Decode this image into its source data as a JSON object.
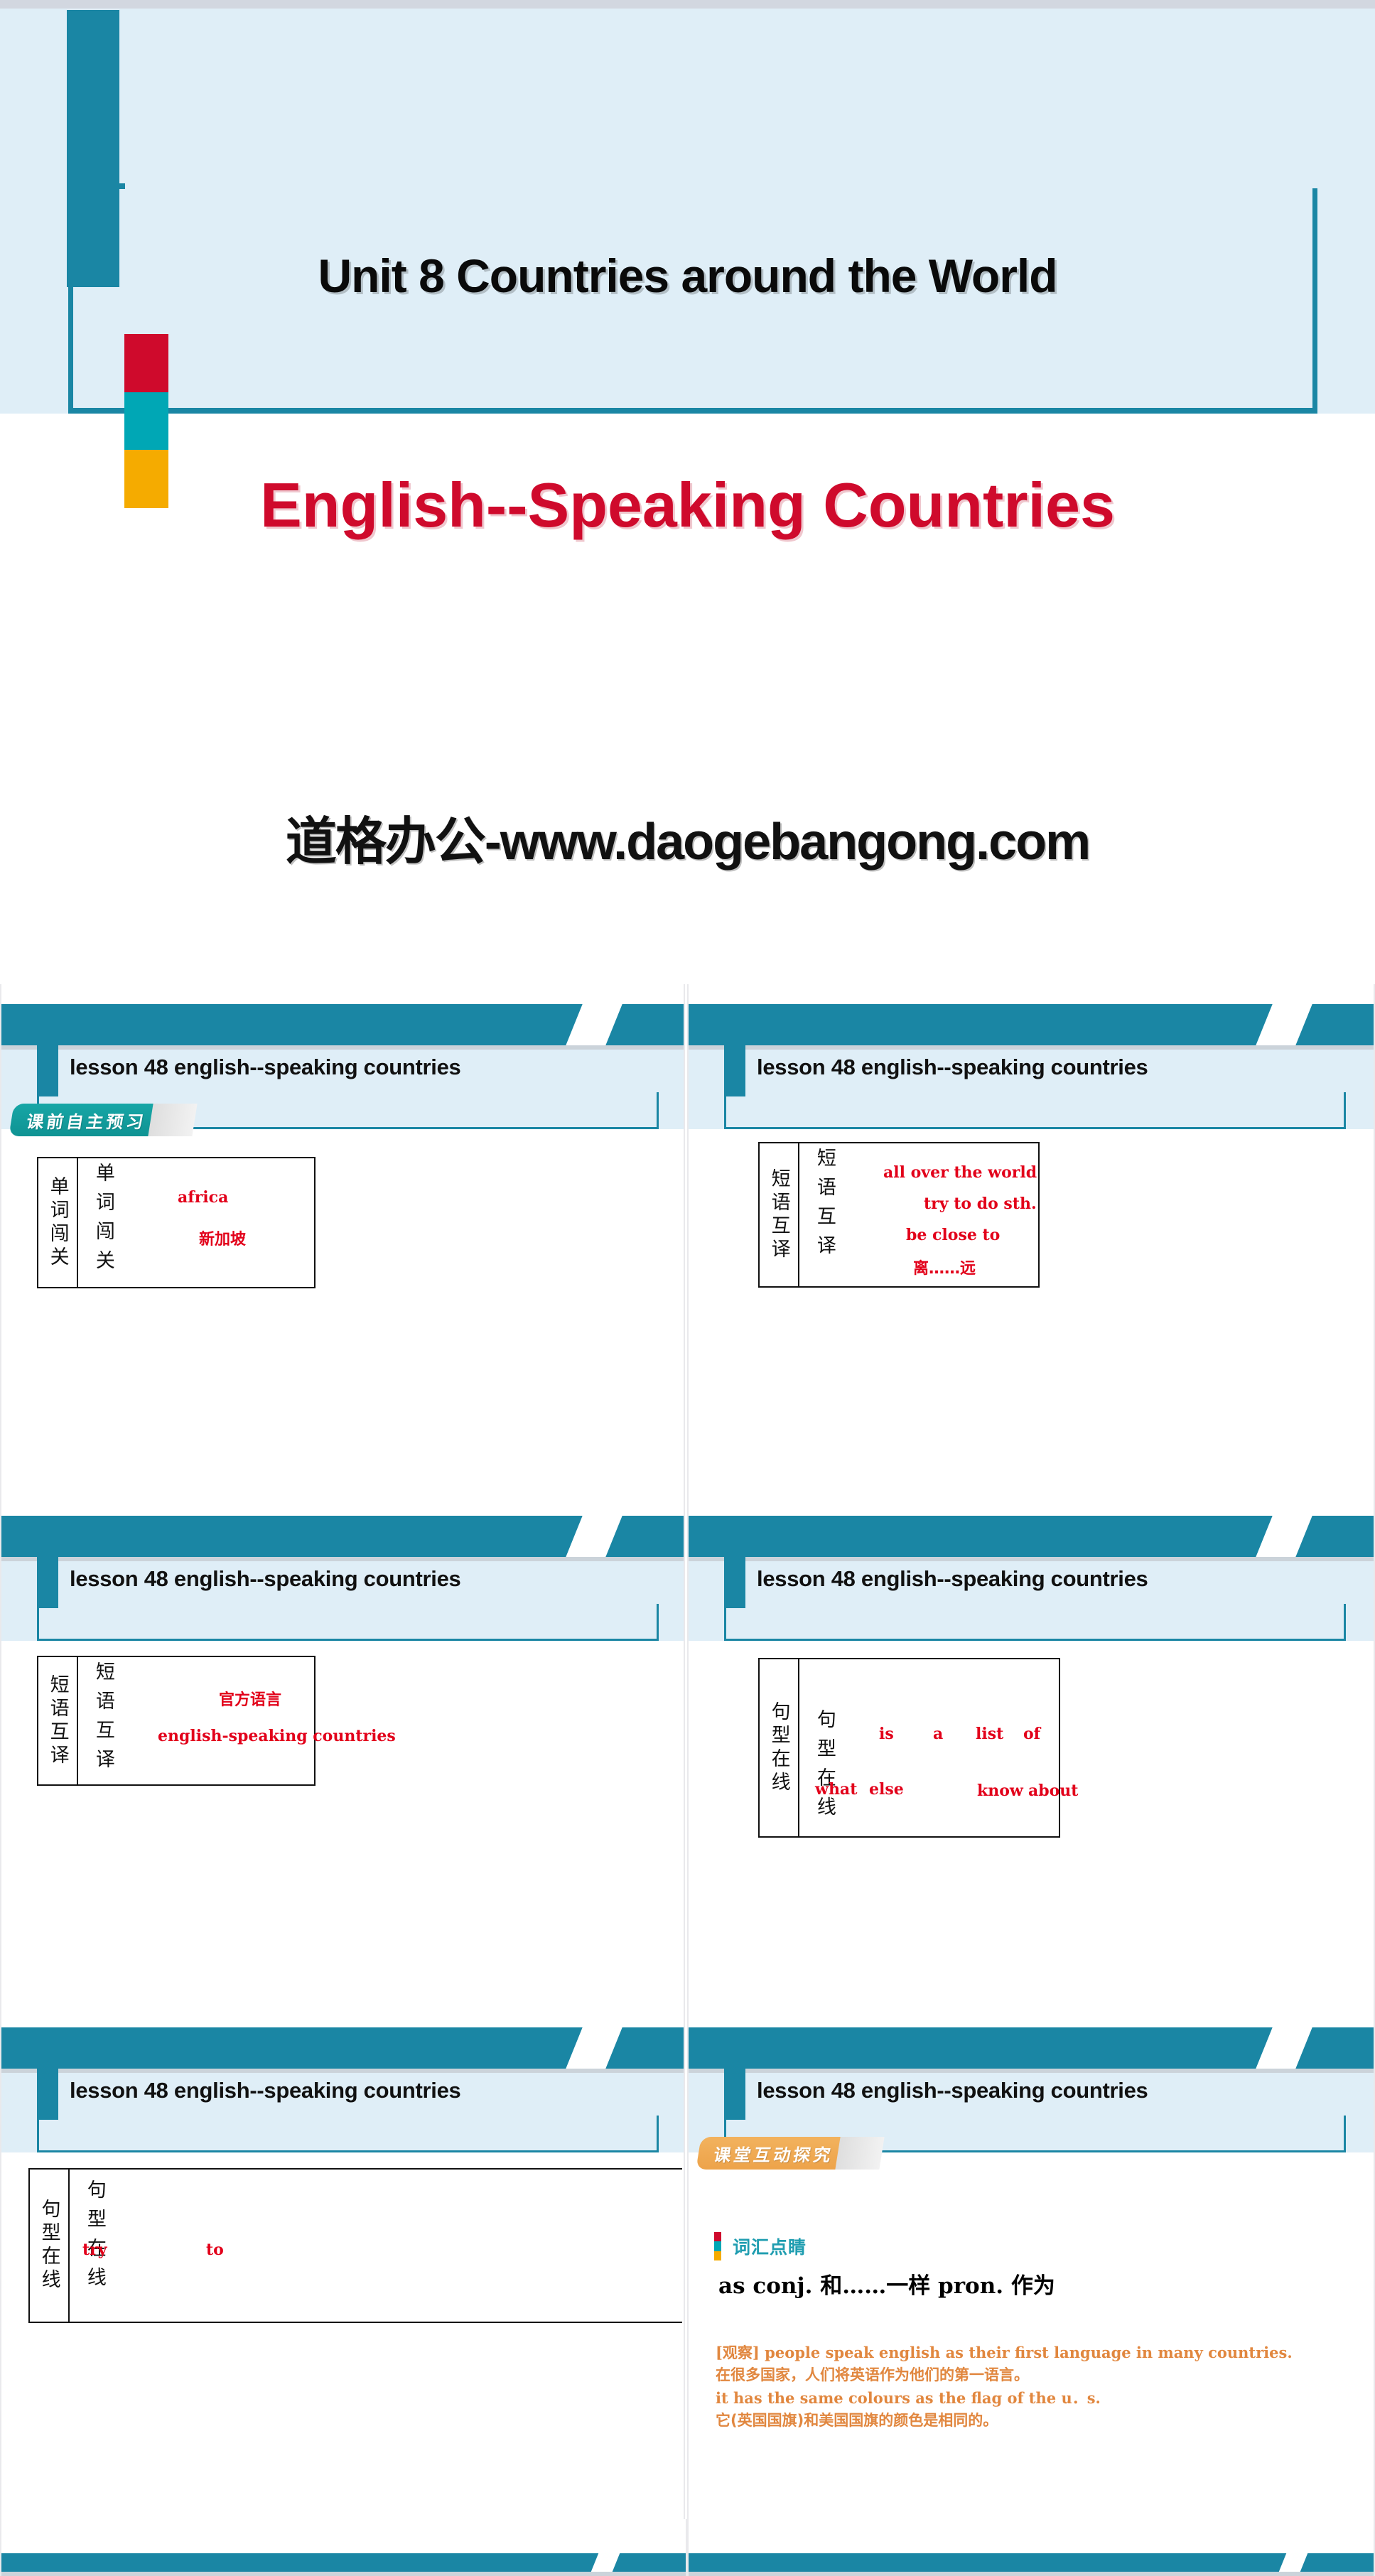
{
  "hero": {
    "unit_title": "Unit 8 Countries around the World",
    "main_title": "English--Speaking  Countries",
    "url": "道格办公-www.daogebangong.com",
    "bar_colors": [
      "#cf0a2c",
      "#00a7b5",
      "#f5ab00"
    ]
  },
  "slide_title": "lesson 48   english--speaking countries",
  "badges": {
    "preview": "课前自主预习",
    "interactive": "课堂互动探究"
  },
  "thumbs": [
    {
      "index": 1,
      "title": "lesson 48   english--speaking countries",
      "badge": "课前自主预习",
      "label_left": "单词闯关",
      "label_right": "单词闯关",
      "answers": [
        "africa",
        "新加坡"
      ]
    },
    {
      "index": 2,
      "title": "lesson 48   english--speaking countries",
      "label_left": "短语互译",
      "label_right": "短语互译",
      "answers": [
        "all over the world",
        "try to do sth.",
        "be close to",
        "离……远"
      ]
    },
    {
      "index": 3,
      "title": "lesson 48   english--speaking countries",
      "label_left": "短语互译",
      "label_right": "短语互译",
      "answers": [
        "官方语言",
        "english-speaking countries"
      ]
    },
    {
      "index": 4,
      "title": "lesson 48   english--speaking countries",
      "label_left": "句型在线",
      "label_right": "句型在线",
      "answers": [
        "is",
        "a",
        "list",
        "of",
        "what",
        "else",
        "know",
        "about"
      ]
    },
    {
      "index": 5,
      "title": "lesson 48   english--speaking countries",
      "label_left": "句型在线",
      "label_right": "句型在线",
      "answers": [
        "try",
        "to"
      ]
    },
    {
      "index": 6,
      "title": "lesson 48   english--speaking countries",
      "badge": "课堂互动探究",
      "vocab_heading": "词汇点睛",
      "vocab_entry": "as conj. 和……一样  pron. 作为",
      "example_lines": [
        "[观察] people speak english as their first language in many countries.",
        "在很多国家，人们将英语作为他们的第一语言。",
        "it has the same colours as the flag of the u．s.",
        "它(英国国旗)和美国国旗的颜色是相同的。"
      ]
    }
  ],
  "colors": {
    "teal": "#1a86a4",
    "light_blue": "#dfeef7",
    "red_answer": "#e2001a",
    "orange_example": "#e1873f",
    "vocab_heading": "#1f9db0"
  }
}
